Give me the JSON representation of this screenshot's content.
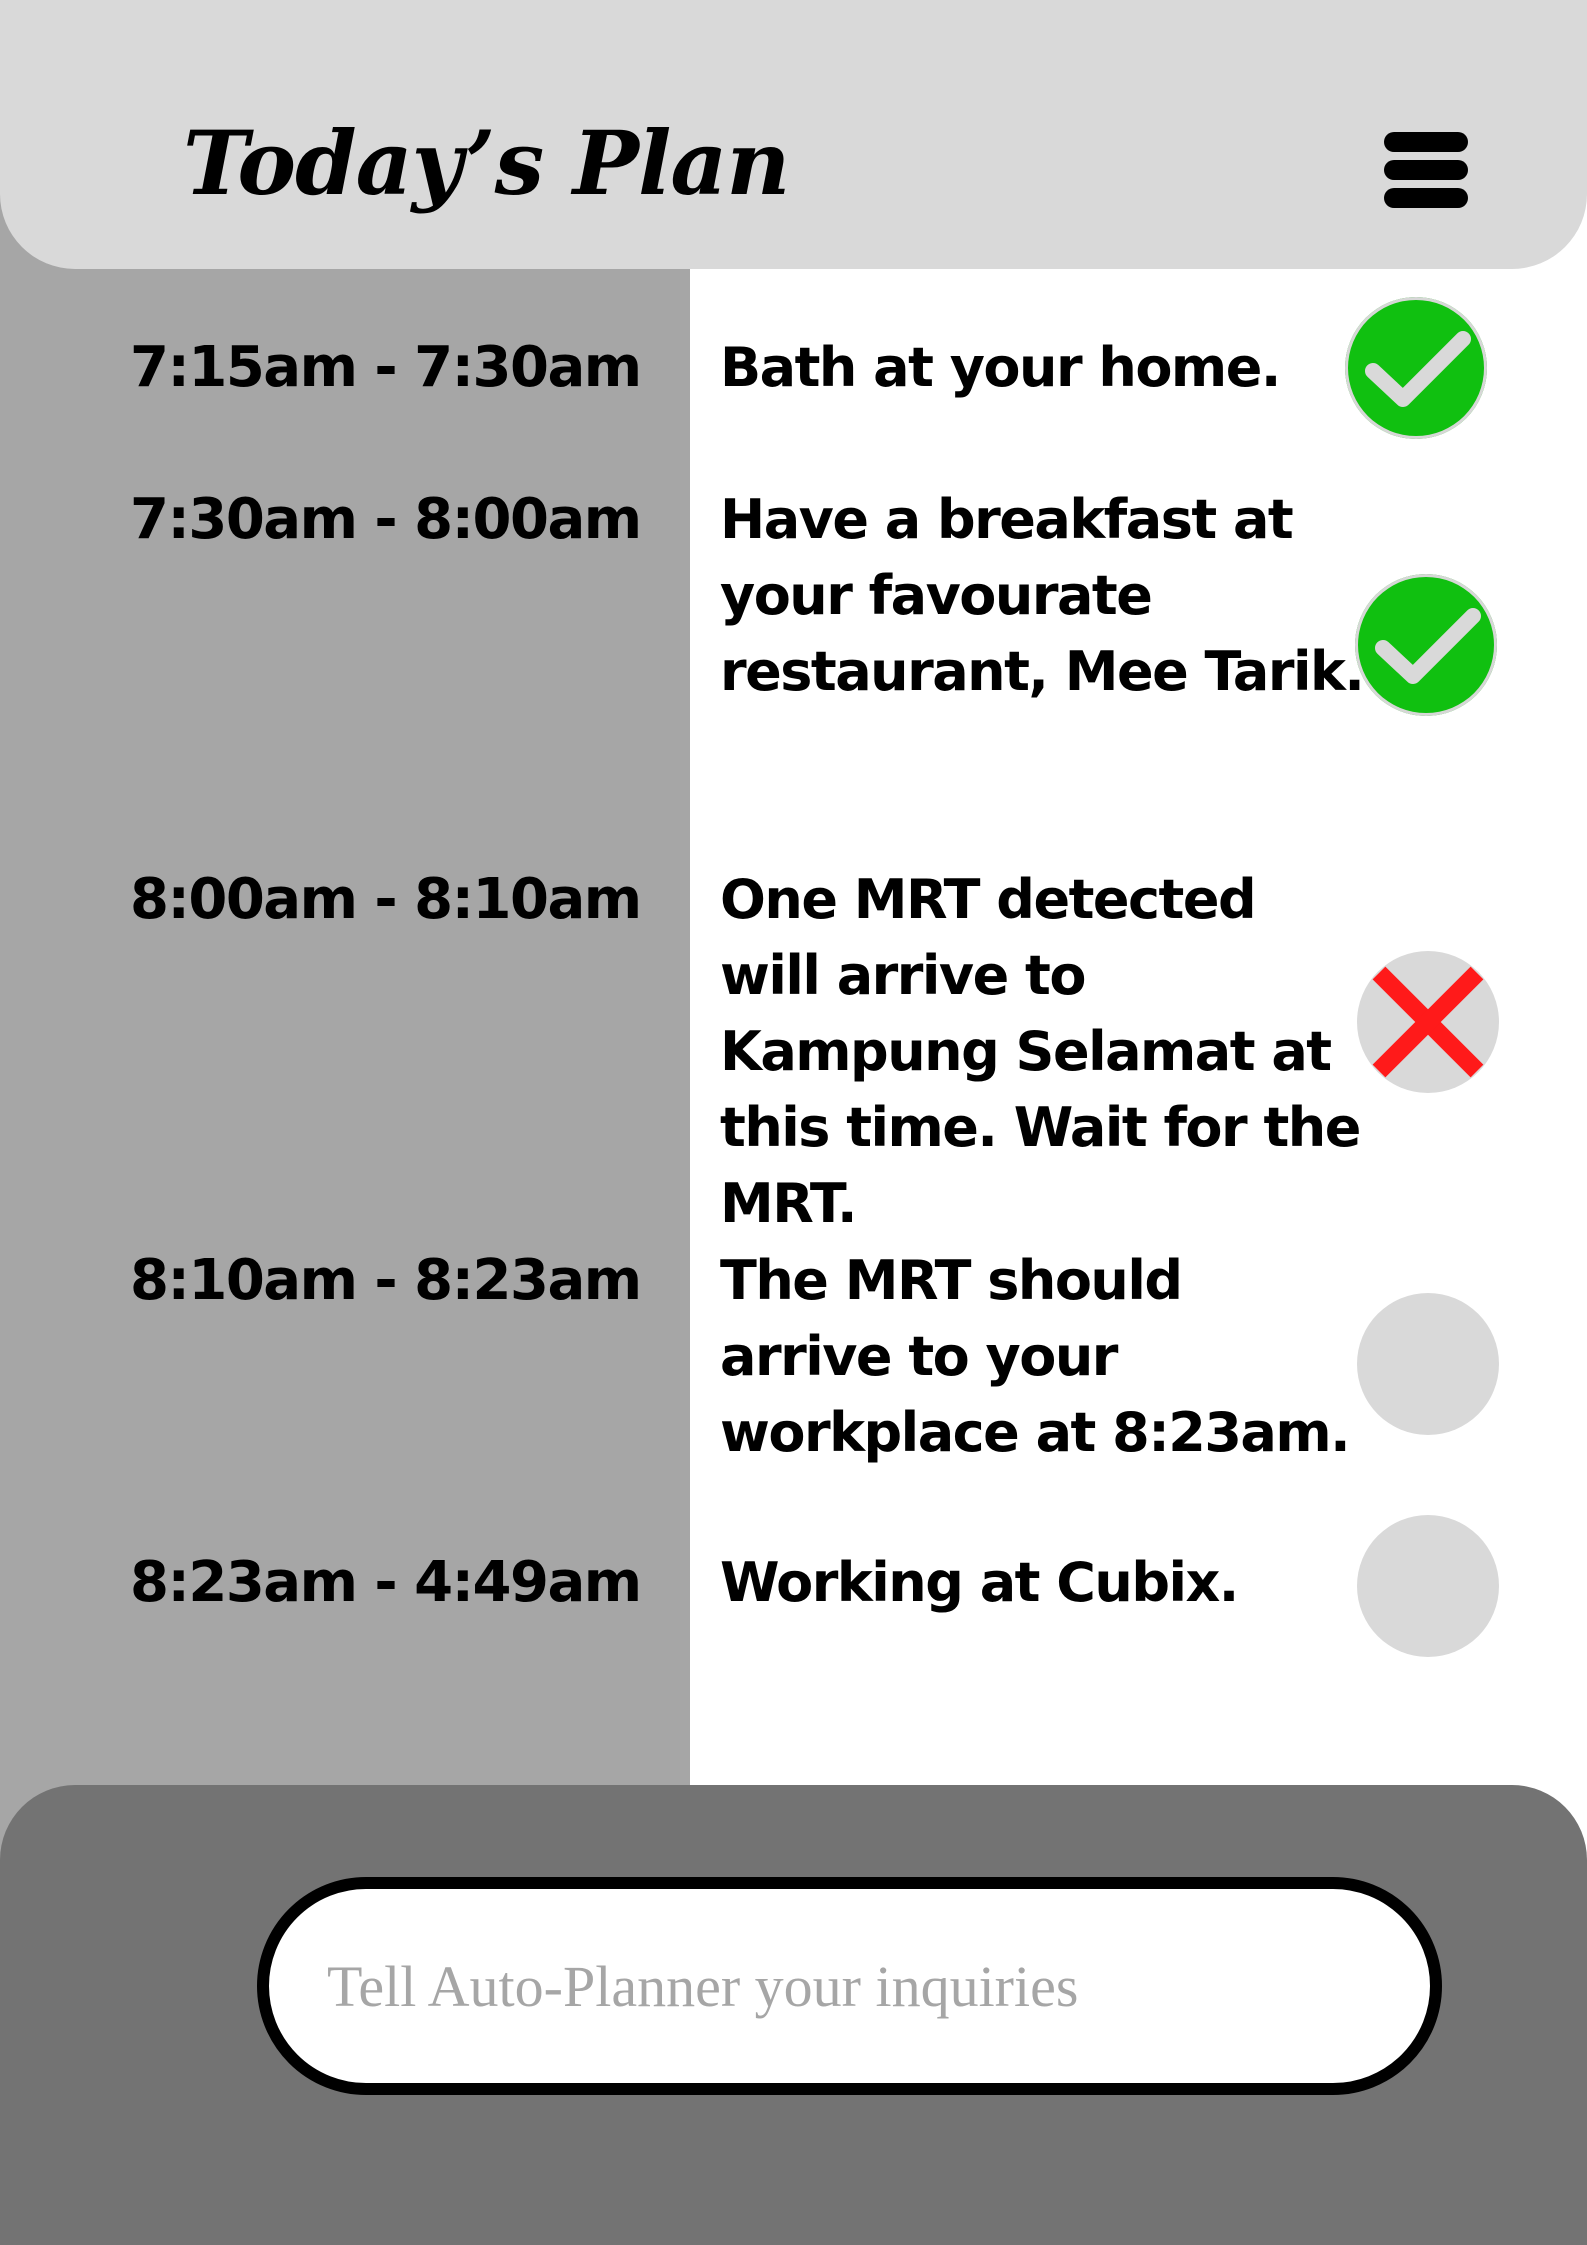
{
  "header": {
    "title": "Today’s Plan",
    "menu_icon": "hamburger-menu-icon"
  },
  "schedule": [
    {
      "time": "7:15am - 7:30am",
      "task": "Bath at your home.",
      "status": "done",
      "status_icon": "check-icon"
    },
    {
      "time": "7:30am - 8:00am",
      "task": "Have a breakfast at your favourate restaurant, Mee Tarik.",
      "status": "done",
      "status_icon": "check-icon"
    },
    {
      "time": "8:00am - 8:10am",
      "task": "One MRT detected will arrive to  Kampung Selamat at this time. Wait for the MRT.",
      "status": "failed",
      "status_icon": "cross-icon"
    },
    {
      "time": "8:10am - 8:23am",
      "task": "The MRT should arrive to your workplace at 8:23am.",
      "status": "pending",
      "status_icon": "empty-circle"
    },
    {
      "time": "8:23am - 4:49am",
      "task": "Working at Cubix.",
      "status": "pending",
      "status_icon": "empty-circle"
    }
  ],
  "input": {
    "placeholder": "Tell Auto-Planner your inquiries",
    "value": ""
  },
  "colors": {
    "header_bg": "#d9d9d9",
    "time_column_bg": "#a6a6a6",
    "bottom_panel_bg": "#737373",
    "done": "#10c010",
    "failed": "#ff1a1a",
    "pending": "#d9d9d9"
  }
}
